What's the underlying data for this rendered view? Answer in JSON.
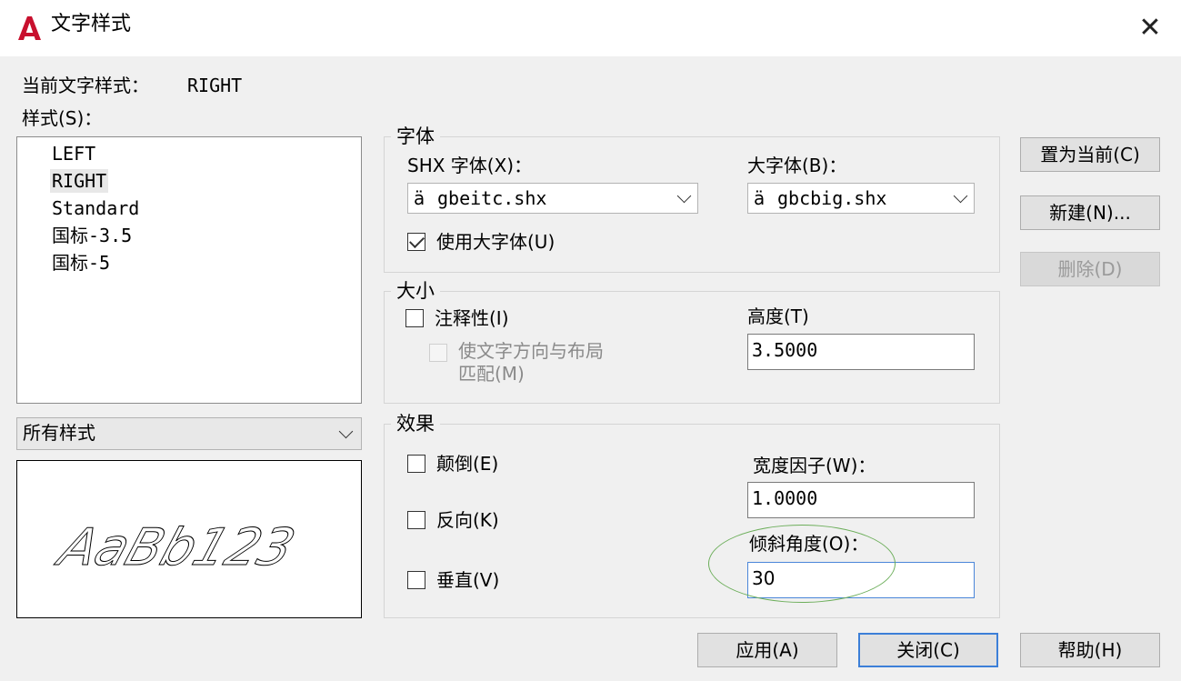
{
  "window": {
    "title": "文字样式",
    "close_glyph": "✕"
  },
  "current_style": {
    "label": "当前文字样式：",
    "value": "RIGHT"
  },
  "styles_list": {
    "label": "样式(S)：",
    "items": [
      "LEFT",
      "RIGHT",
      "Standard",
      "国标-3.5",
      "国标-5"
    ],
    "selected": "RIGHT"
  },
  "style_filter": {
    "value": "所有样式"
  },
  "preview": {
    "text": "AaBb123"
  },
  "font_group": {
    "legend": "字体",
    "shx_label": "SHX 字体(X)：",
    "shx_value": "gbeitc.shx",
    "big_label": "大字体(B)：",
    "big_value": "gbcbig.shx",
    "use_big_font_label": "使用大字体(U)",
    "use_big_font_checked": true,
    "font_icon": "ä"
  },
  "size_group": {
    "legend": "大小",
    "annotative_label": "注释性(I)",
    "match_orientation_label_1": "使文字方向与布局",
    "match_orientation_label_2": "匹配(M)",
    "height_label": "高度(T)",
    "height_value": "3.5000"
  },
  "effects_group": {
    "legend": "效果",
    "upside_down_label": "颠倒(E)",
    "backwards_label": "反向(K)",
    "vertical_label": "垂直(V)",
    "width_factor_label": "宽度因子(W)：",
    "width_factor_value": "1.0000",
    "oblique_label": "倾斜角度(O)：",
    "oblique_value": "30"
  },
  "buttons": {
    "set_current": "置为当前(C)",
    "new": "新建(N)...",
    "delete": "删除(D)",
    "apply": "应用(A)",
    "close": "关闭(C)",
    "help": "帮助(H)"
  },
  "colors": {
    "highlight_ellipse": "#6cae5a",
    "default_button_border": "#3c7fd8",
    "app_icon": "#c8102e"
  }
}
